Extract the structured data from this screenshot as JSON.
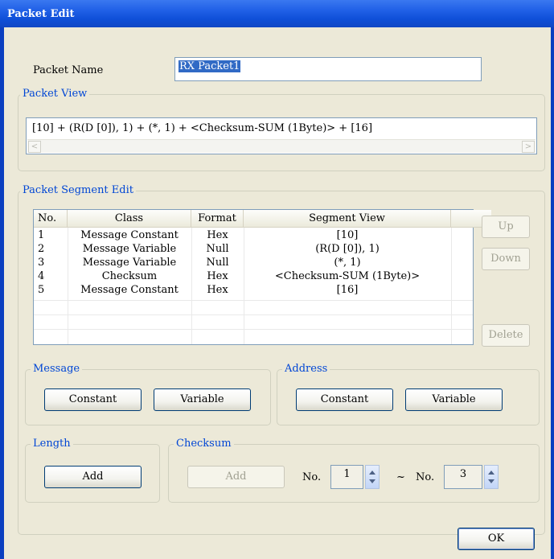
{
  "window": {
    "title": "Packet Edit"
  },
  "packet_name": {
    "label": "Packet Name",
    "value": "RX Packet1"
  },
  "packet_view": {
    "legend": "Packet View",
    "text": "[10] + (R(D [0]), 1) + (*, 1) + <Checksum-SUM (1Byte)> + [16]",
    "scroll_left": "<",
    "scroll_right": ">"
  },
  "segment_edit": {
    "legend": "Packet Segment Edit",
    "columns": [
      "No.",
      "Class",
      "Format",
      "Segment View"
    ],
    "rows": [
      {
        "no": "1",
        "class": "Message Constant",
        "format": "Hex",
        "view": "[10]"
      },
      {
        "no": "2",
        "class": "Message Variable",
        "format": "Null",
        "view": "(R(D [0]), 1)"
      },
      {
        "no": "3",
        "class": "Message Variable",
        "format": "Null",
        "view": "(*, 1)"
      },
      {
        "no": "4",
        "class": "Checksum",
        "format": "Hex",
        "view": "<Checksum-SUM (1Byte)>"
      },
      {
        "no": "5",
        "class": "Message Constant",
        "format": "Hex",
        "view": "[16]"
      }
    ],
    "up_label": "Up",
    "down_label": "Down",
    "delete_label": "Delete"
  },
  "message": {
    "legend": "Message",
    "constant_label": "Constant",
    "variable_label": "Variable"
  },
  "address": {
    "legend": "Address",
    "constant_label": "Constant",
    "variable_label": "Variable"
  },
  "length": {
    "legend": "Length",
    "add_label": "Add"
  },
  "checksum": {
    "legend": "Checksum",
    "add_label": "Add",
    "from_label": "No.",
    "from_value": "1",
    "tilde": "~",
    "to_label": "No.",
    "to_value": "3"
  },
  "ok_label": "OK",
  "colors": {
    "title_bar": "#1f5fe6",
    "legend_text": "#0046d5",
    "dialog_bg": "#ece9d8"
  }
}
